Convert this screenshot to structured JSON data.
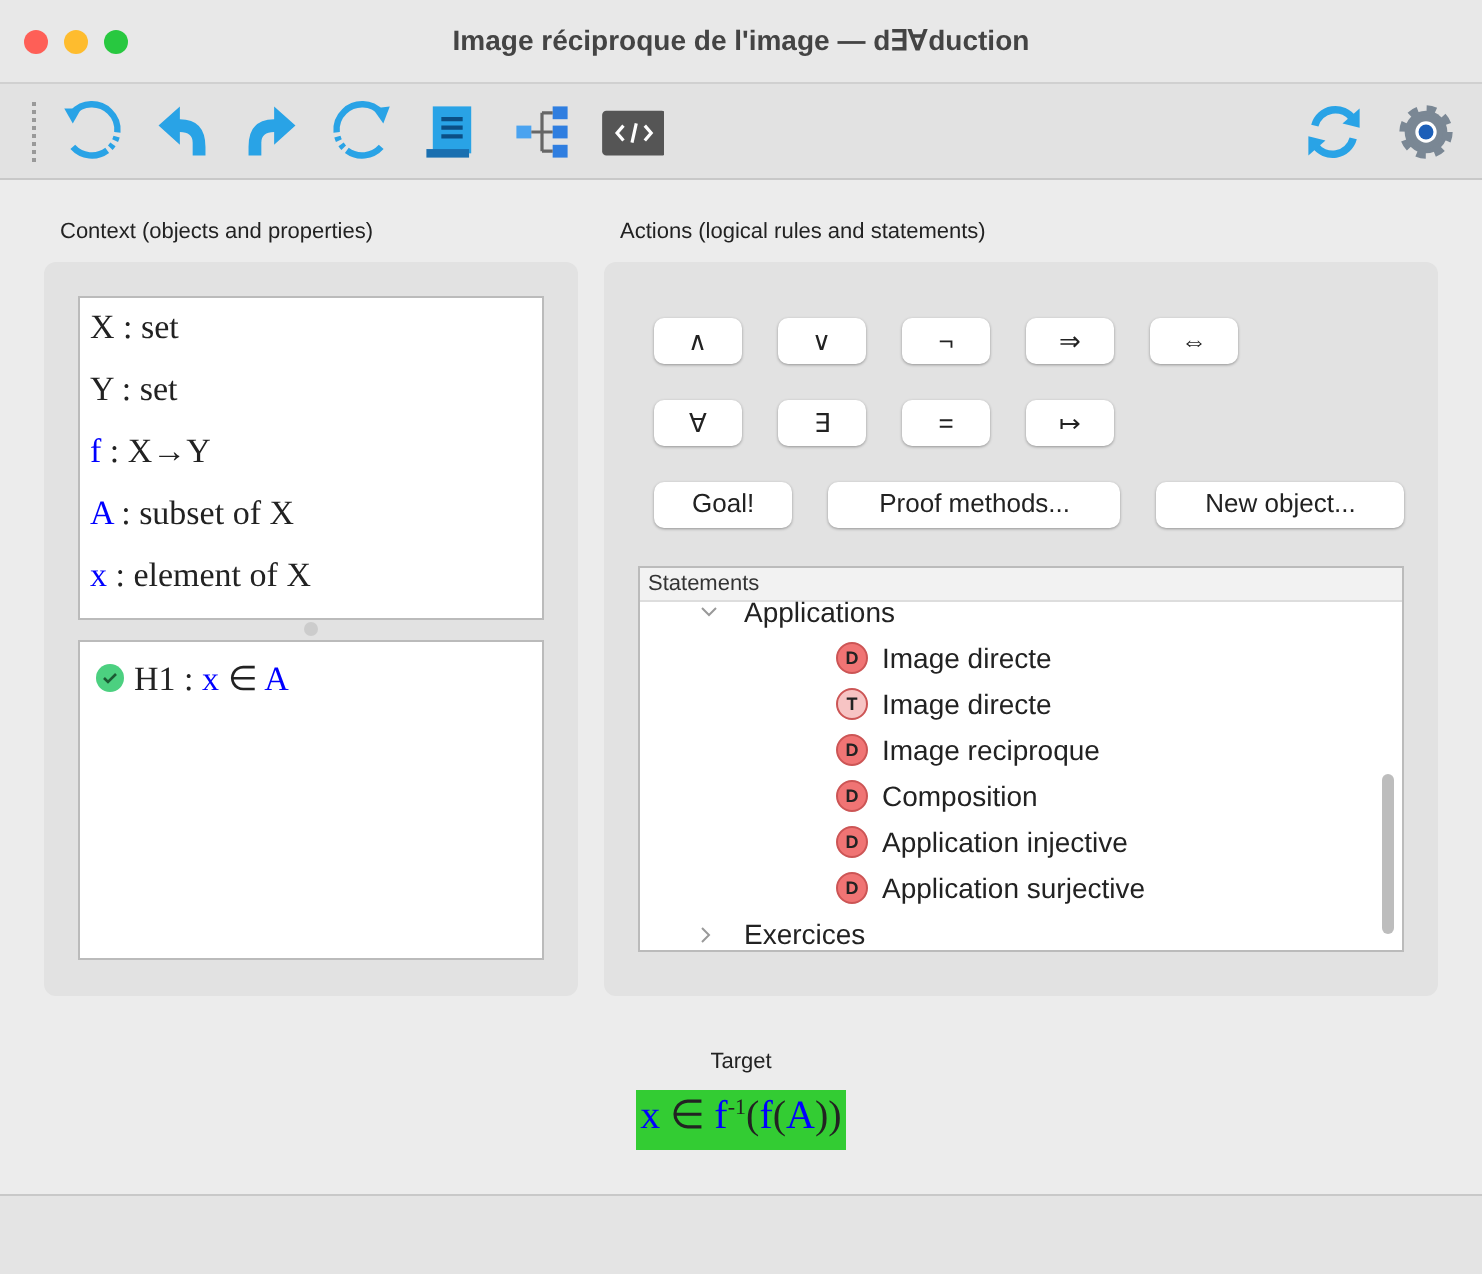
{
  "window": {
    "title": "Image réciproque de l'image — d∃∀duction"
  },
  "toolbar": {
    "left": [
      {
        "kind": "undo-all"
      },
      {
        "kind": "undo"
      },
      {
        "kind": "redo"
      },
      {
        "kind": "redo-all"
      },
      {
        "kind": "scroll"
      },
      {
        "kind": "tree"
      },
      {
        "kind": "code"
      }
    ],
    "right": [
      {
        "kind": "sync"
      },
      {
        "kind": "settings"
      }
    ]
  },
  "context": {
    "label": "Context (objects and properties)",
    "objects": [
      {
        "segments": [
          {
            "text": "X"
          },
          {
            "text": " : set"
          }
        ]
      },
      {
        "segments": [
          {
            "text": "Y"
          },
          {
            "text": " : set"
          }
        ]
      },
      {
        "segments": [
          {
            "text": "f",
            "color": "#0000ff"
          },
          {
            "text": " : X→Y"
          }
        ]
      },
      {
        "segments": [
          {
            "text": "A",
            "color": "#0000ff"
          },
          {
            "text": " : subset of X"
          }
        ]
      },
      {
        "segments": [
          {
            "text": "x",
            "color": "#0000ff"
          },
          {
            "text": " : element of X"
          }
        ]
      }
    ],
    "properties": [
      {
        "checked": true,
        "segments": [
          {
            "text": "H1 : "
          },
          {
            "text": "x",
            "color": "#0000ff"
          },
          {
            "text": " ∈ "
          },
          {
            "text": "A",
            "color": "#0000ff"
          }
        ]
      }
    ]
  },
  "actions": {
    "label": "Actions (logical rules and statements)",
    "logic_rows": [
      [
        "∧",
        "∨",
        "¬",
        "⇒",
        "⇔"
      ],
      [
        "∀",
        "∃",
        "=",
        "↦"
      ]
    ],
    "buttons": [
      "Goal!",
      "Proof methods...",
      "New object..."
    ],
    "statements": {
      "header": "Statements",
      "items": [
        {
          "label": "Applications",
          "expanded": true,
          "children": [
            {
              "label": "Image directe",
              "badge": "D"
            },
            {
              "label": "Image directe",
              "badge": "T"
            },
            {
              "label": "Image reciproque",
              "badge": "D"
            },
            {
              "label": "Composition",
              "badge": "D"
            },
            {
              "label": "Application injective",
              "badge": "D"
            },
            {
              "label": "Application surjective",
              "badge": "D"
            }
          ]
        },
        {
          "label": "Exercices",
          "expanded": false
        }
      ]
    }
  },
  "target": {
    "label": "Target",
    "segments": [
      {
        "text": "x",
        "color": "#0000ff"
      },
      {
        "text": " ∈ "
      },
      {
        "text": "f",
        "color": "#0000ff"
      },
      {
        "text": "-1",
        "kind": "sup"
      },
      {
        "text": "("
      },
      {
        "text": "f",
        "color": "#0000ff"
      },
      {
        "text": "("
      },
      {
        "text": "A",
        "color": "#0000ff"
      },
      {
        "text": "))"
      }
    ]
  }
}
